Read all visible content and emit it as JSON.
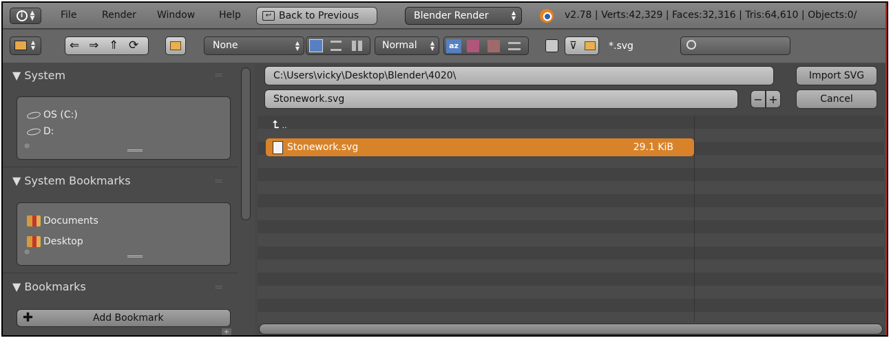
{
  "menubar": {
    "info_icon": "info-icon",
    "menus": [
      "File",
      "Render",
      "Window",
      "Help"
    ],
    "back_label": "Back to Previous",
    "engine": "Blender Render",
    "stats": "v2.78 | Verts:42,329 | Faces:32,316 | Tris:64,610 | Objects:0/"
  },
  "toolbar": {
    "recent_value": "None",
    "sort_value": "Normal",
    "filter_text": "*.svg",
    "search_placeholder": ""
  },
  "sidebar": {
    "system_header": "System",
    "system_items": [
      "OS (C:)",
      "D:"
    ],
    "system_bookmarks_header": "System Bookmarks",
    "system_bookmarks": [
      "Documents",
      "Desktop"
    ],
    "bookmarks_header": "Bookmarks",
    "add_bookmark_label": "Add Bookmark"
  },
  "main": {
    "directory": "C:\\Users\\vicky\\Desktop\\Blender\\4020\\",
    "filename": "Stonework.svg",
    "import_label": "Import SVG",
    "cancel_label": "Cancel",
    "parent_label": "..",
    "files": [
      {
        "name": "Stonework.svg",
        "size": "29.1 KiB",
        "selected": true
      }
    ]
  },
  "colors": {
    "selection": "#d8832a",
    "background": "#4a4a4a",
    "header": "#878787"
  }
}
